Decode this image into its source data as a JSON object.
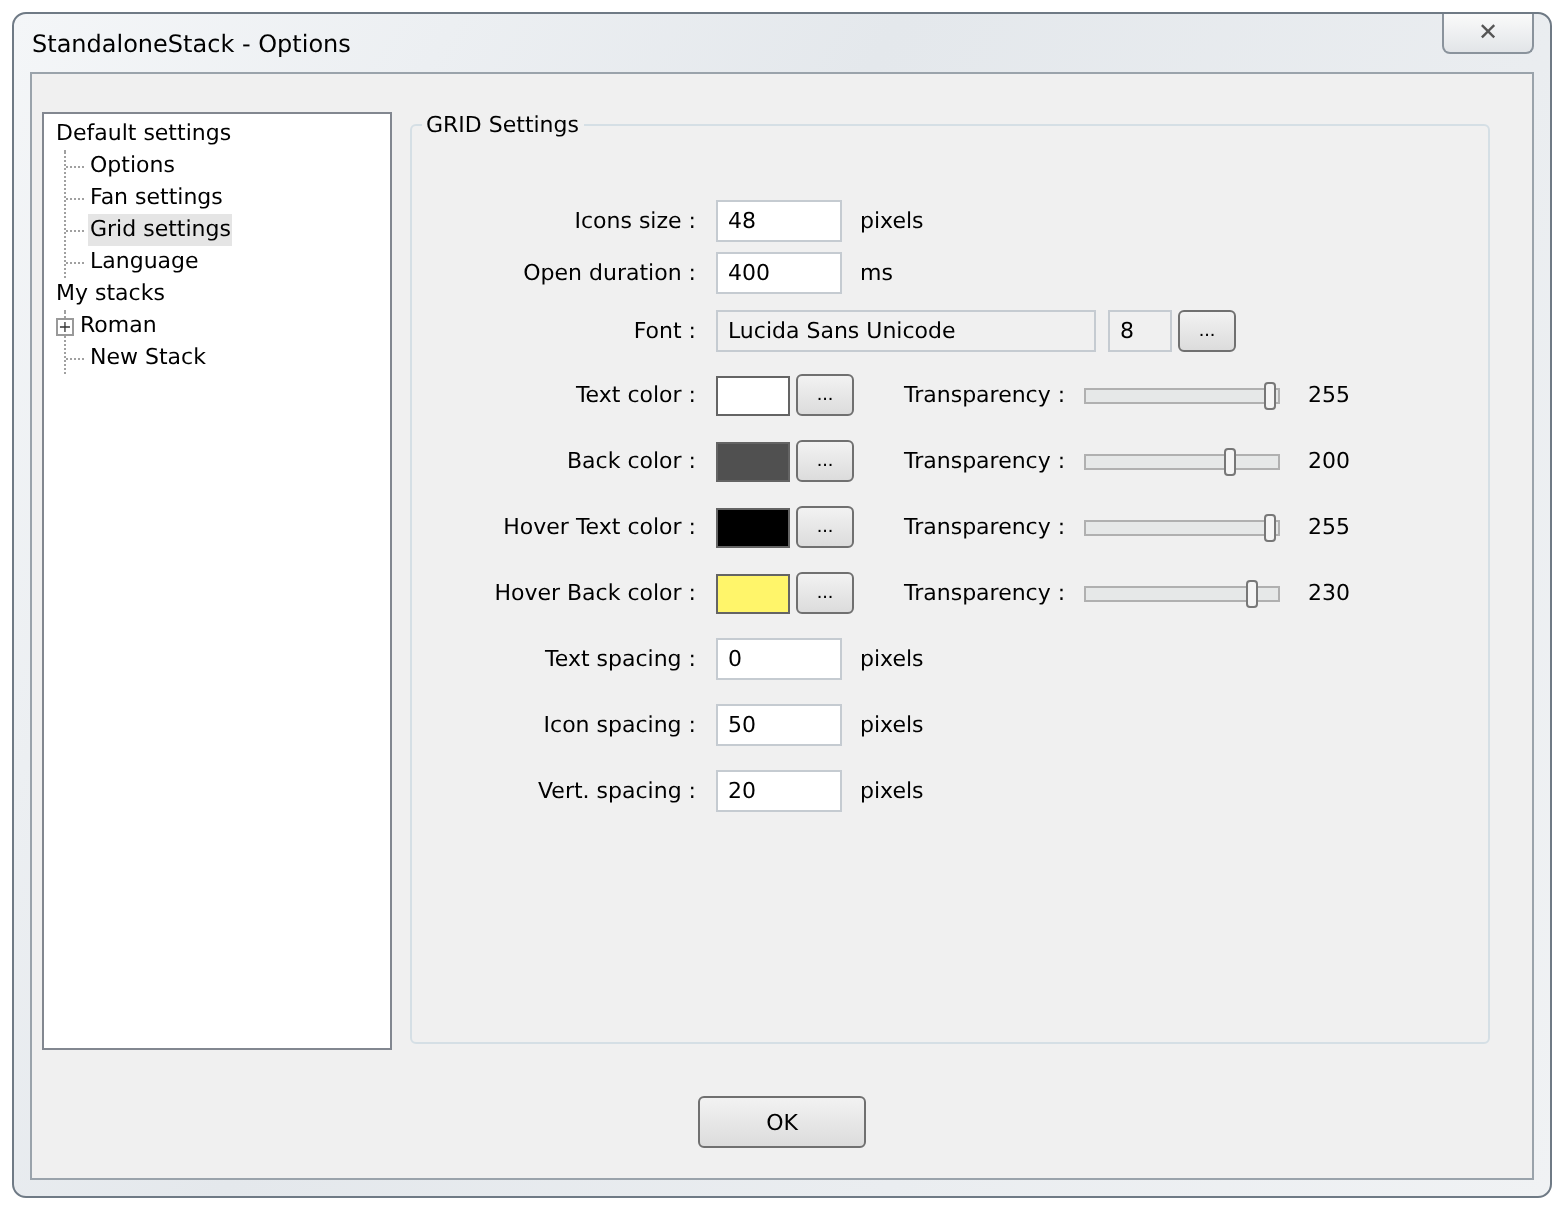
{
  "window": {
    "title": "StandaloneStack - Options",
    "close": "✕"
  },
  "tree": [
    {
      "label": "Default settings",
      "selected": false,
      "children": [
        {
          "label": "Options",
          "selected": false
        },
        {
          "label": "Fan settings",
          "selected": false
        },
        {
          "label": "Grid settings",
          "selected": true
        },
        {
          "label": "Language",
          "selected": false
        }
      ]
    },
    {
      "label": "My stacks",
      "selected": false,
      "children": [
        {
          "label": "Roman",
          "selected": false,
          "expanded": false,
          "expander": "+"
        },
        {
          "label": "New Stack",
          "selected": false
        }
      ]
    }
  ],
  "group": {
    "title": "GRID Settings",
    "rows": [
      {
        "kind": "number",
        "label": "Icons size :",
        "value": "48",
        "unit": "pixels"
      },
      {
        "kind": "number",
        "label": "Open duration :",
        "value": "400",
        "unit": "ms"
      },
      {
        "kind": "font",
        "label": "Font :",
        "value": "Lucida Sans Unicode",
        "size": "8",
        "button": "..."
      },
      {
        "kind": "color",
        "label": "Text color :",
        "color": "#ffffff",
        "button": "...",
        "slider_label": "Transparency :",
        "level": 1.0,
        "reading": "255"
      },
      {
        "kind": "color",
        "label": "Back color :",
        "color": "#505050",
        "button": "...",
        "slider_label": "Transparency :",
        "level": 0.78,
        "reading": "200"
      },
      {
        "kind": "color",
        "label": "Hover Text color :",
        "color": "#000000",
        "button": "...",
        "slider_label": "Transparency :",
        "level": 1.0,
        "reading": "255"
      },
      {
        "kind": "color",
        "label": "Hover Back color :",
        "color": "#fff56a",
        "button": "...",
        "slider_label": "Transparency :",
        "level": 0.9,
        "reading": "230"
      },
      {
        "kind": "number",
        "label": "Text spacing :",
        "value": "0",
        "unit": "pixels"
      },
      {
        "kind": "number",
        "label": "Icon spacing :",
        "value": "50",
        "unit": "pixels"
      },
      {
        "kind": "number",
        "label": "Vert. spacing :",
        "value": "20",
        "unit": "pixels"
      }
    ]
  },
  "buttons": [
    "OK"
  ]
}
